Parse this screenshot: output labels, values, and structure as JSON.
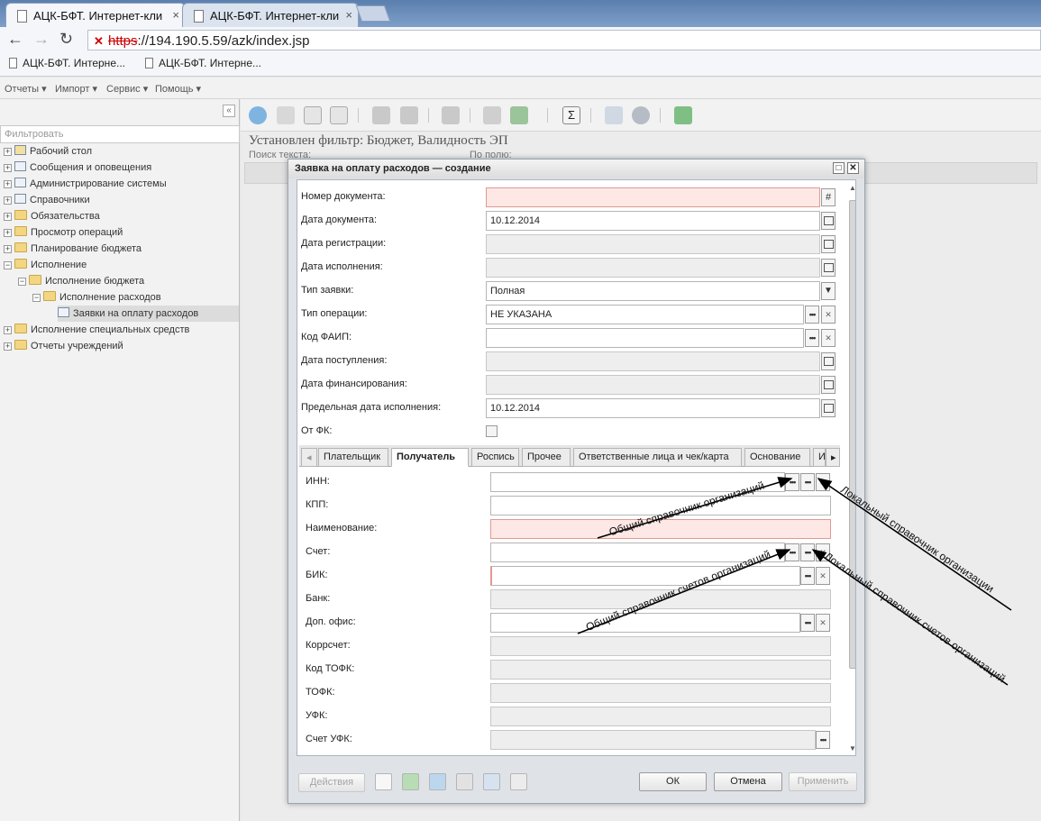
{
  "browser": {
    "tabs": [
      {
        "title": "АЦК-БФТ. Интернет-кли",
        "close": "×"
      },
      {
        "title": "АЦК-БФТ. Интернет-кли",
        "close": "×"
      }
    ],
    "url_scheme": "https",
    "url_rest": "://194.190.5.59/azk/index.jsp",
    "bookmarks": [
      "АЦК-БФТ. Интерне...",
      "АЦК-БФТ. Интерне..."
    ]
  },
  "menubar": {
    "items": [
      "Отчеты ▾",
      "Импорт ▾",
      "Сервис ▾",
      "Помощь ▾"
    ]
  },
  "sidebar": {
    "filter_placeholder": "Фильтровать",
    "items": [
      {
        "label": "Рабочий стол"
      },
      {
        "label": "Сообщения и оповещения"
      },
      {
        "label": "Администрирование системы"
      },
      {
        "label": "Справочники"
      },
      {
        "label": "Обязательства"
      },
      {
        "label": "Просмотр операций"
      },
      {
        "label": "Планирование бюджета"
      },
      {
        "label": "Исполнение"
      },
      {
        "label": "Исполнение бюджета"
      },
      {
        "label": "Исполнение расходов"
      },
      {
        "label": "Заявки на оплату расходов"
      },
      {
        "label": "Исполнение специальных средств"
      },
      {
        "label": "Отчеты учреждений"
      }
    ]
  },
  "main": {
    "filter_caption": "Установлен фильтр: Бюджет, Валидность ЭП",
    "search_label": "Поиск текста:",
    "field_label": "По полю:"
  },
  "dialog": {
    "title": "Заявка на оплату расходов — создание",
    "fields": {
      "doc_number": {
        "label": "Номер документа:",
        "value": ""
      },
      "doc_date": {
        "label": "Дата документа:",
        "value": "10.12.2014"
      },
      "reg_date": {
        "label": "Дата регистрации:",
        "value": ""
      },
      "exec_date": {
        "label": "Дата исполнения:",
        "value": ""
      },
      "request_type": {
        "label": "Тип заявки:",
        "value": "Полная"
      },
      "operation_type": {
        "label": "Тип операции:",
        "value": "НЕ УКАЗАНА"
      },
      "faip_code": {
        "label": "Код ФАИП:",
        "value": ""
      },
      "receipt_date": {
        "label": "Дата поступления:",
        "value": ""
      },
      "financing_date": {
        "label": "Дата финансирования:",
        "value": ""
      },
      "deadline_date": {
        "label": "Предельная дата исполнения:",
        "value": "10.12.2014"
      },
      "from_fk": {
        "label": "От ФК:",
        "checked": false
      }
    },
    "tabs": [
      "Плательщик",
      "Получатель",
      "Роспись",
      "Прочее",
      "Ответственные лица и чек/карта",
      "Основание",
      "И"
    ],
    "active_tab": "Получатель",
    "recipient": {
      "inn": "ИНН:",
      "kpp": "КПП:",
      "name": "Наименование:",
      "account": "Счет:",
      "bik": "БИК:",
      "bank": "Банк:",
      "office": "Доп. офис:",
      "corr": "Коррсчет:",
      "tofk_code": "Код ТОФК:",
      "tofk": "ТОФК:",
      "ufk": "УФК:",
      "ufk_account": "Счет УФК:"
    },
    "footer": {
      "actions": "Действия",
      "ok": "ОК",
      "cancel": "Отмена",
      "apply": "Применить"
    }
  },
  "annotations": {
    "general_orgs": "Общий справочник организаций",
    "local_orgs": "Локальный справочник организации",
    "general_accounts": "Общий справочник счетов организаций",
    "local_accounts": "Локальный справочник счетов организаций"
  },
  "colors": {
    "required_field": "#fde8e6",
    "disabled_field": "#eeeeee",
    "chrome_blue": "#5b7fae"
  }
}
